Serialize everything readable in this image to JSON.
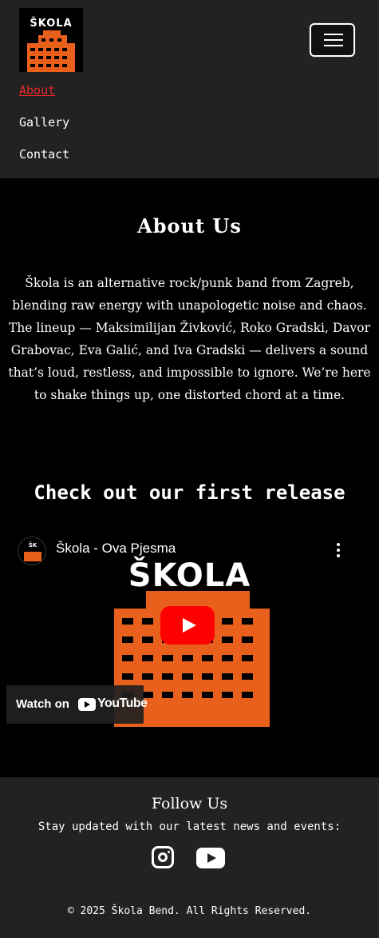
{
  "logo": {
    "text": "ŠKOLA"
  },
  "nav": {
    "items": [
      "About",
      "Gallery",
      "Contact"
    ],
    "active": "About"
  },
  "about": {
    "title": "About Us",
    "text": "Škola is an alternative rock/punk band from Zagreb, blending raw energy with unapologetic noise and chaos. The lineup — Maksimilijan Živković, Roko Gradski, Davor Grabovac, Eva Galić, and Iva Gradski — delivers a sound that’s loud, restless, and impossible to ignore. We’re here to shake things up, one distorted chord at a time."
  },
  "release": {
    "title": "Check out our first release"
  },
  "video": {
    "title": "Škola - Ova Pjesma",
    "thumbnail_text": "ŠKOLA",
    "watch_label": "Watch on",
    "youtube_label": "YouTube"
  },
  "footer": {
    "title": "Follow Us",
    "subtitle": "Stay updated with our latest news and events:",
    "social": [
      "instagram-icon",
      "youtube-icon"
    ],
    "copyright": "© 2025 Škola Bend. All Rights Reserved."
  },
  "colors": {
    "accent": "#e62a2a",
    "header_bg": "#222222",
    "brand_orange": "#e8601c"
  }
}
